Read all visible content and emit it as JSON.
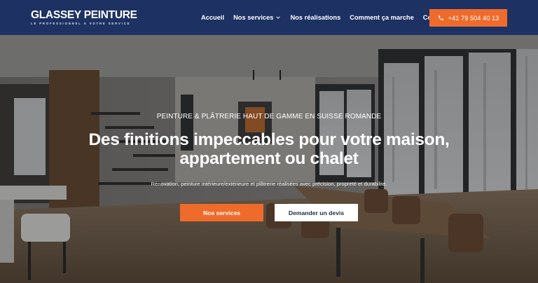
{
  "brand": {
    "name": "GLASSEY PEINTURE",
    "tagline": "LE PROFESSIONNEL À VOTRE SERVICE"
  },
  "nav": {
    "items": [
      {
        "label": "Accueil"
      },
      {
        "label": "Nos services",
        "has_dropdown": true
      },
      {
        "label": "Nos réalisations"
      },
      {
        "label": "Comment ça marche"
      },
      {
        "label": "Contact"
      }
    ],
    "phone": "+41 79 504 40 13",
    "phone_icon": "phone-icon"
  },
  "hero": {
    "eyebrow": "PEINTURE & PLÂTRERIE HAUT DE GAMME EN SUISSE ROMANDE",
    "headline": "Des finitions impeccables pour votre maison, appartement ou chalet",
    "subline": "Rénovation, peinture intérieure/extérieure et plâtrerie réalisées avec précision, propreté et durabilité.",
    "primary_cta": "Nos services",
    "secondary_cta": "Demander un devis"
  },
  "colors": {
    "header_bg": "#1d3163",
    "accent": "#ef6b2c",
    "text_on_dark": "#ffffff"
  }
}
